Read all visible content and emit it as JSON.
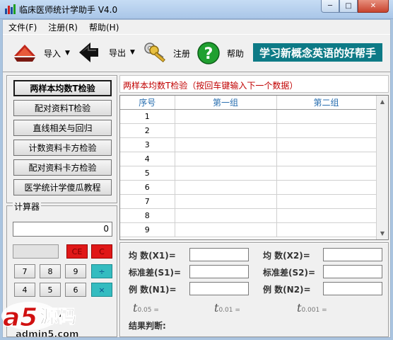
{
  "window": {
    "title": "临床医师统计学助手 V4.0",
    "min": "─",
    "max": "□",
    "close": "✕"
  },
  "menu": [
    "文件(F)",
    "注册(R)",
    "帮助(H)"
  ],
  "toolbar": {
    "import_label": "导入",
    "export_label": "导出",
    "register_label": "注册",
    "help_label": "帮助",
    "ad_text": "学习新概念英语的好帮手"
  },
  "nav": [
    "两样本均数T检验",
    "配对资料T检验",
    "直线相关与回归",
    "计数资料卡方检验",
    "配对资料卡方检验",
    "医学统计学傻瓜教程"
  ],
  "calculator": {
    "title": "计算器",
    "display": "0",
    "keys": [
      "CE",
      "C",
      "7",
      "8",
      "9",
      "÷",
      "4",
      "5",
      "6",
      "×"
    ]
  },
  "test": {
    "caption": "两样本均数T检验（按回车键输入下一个数据）",
    "columns": [
      "序号",
      "第一组",
      "第二组"
    ],
    "rows": [
      "1",
      "2",
      "3",
      "4",
      "5",
      "6",
      "7",
      "8",
      "9"
    ]
  },
  "stats": {
    "mean1": "均  数(X1)=",
    "mean2": "均  数(X2)=",
    "sd1": "标准差(S1)=",
    "sd2": "标准差(S2)=",
    "n1": "例  数(N1)=",
    "n2": "例  数(N2)=",
    "t_symbol": "t",
    "t005": "0.05 =",
    "t001": "0.01 =",
    "t0001": "0.001 =",
    "result": "结果判断:"
  },
  "watermark": {
    "brand": "a5源码",
    "site": "admin5.com"
  },
  "colors": {
    "banner": "#0d7a86",
    "caption_text": "#c00000",
    "header_text": "#2a6fb0",
    "calc_red": "#e01818",
    "calc_teal": "#34bcc0"
  }
}
